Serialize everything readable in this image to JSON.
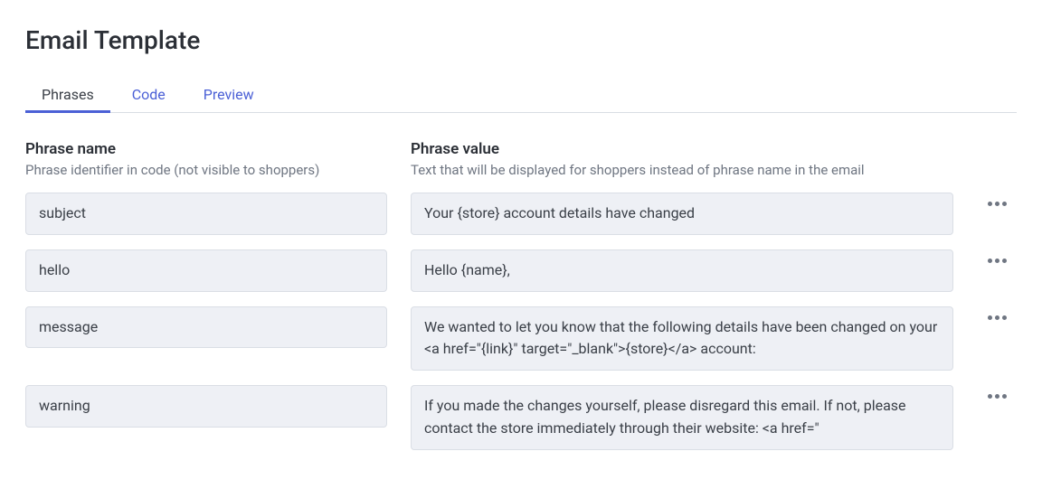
{
  "title": "Email Template",
  "tabs": [
    {
      "label": "Phrases",
      "active": true
    },
    {
      "label": "Code",
      "active": false
    },
    {
      "label": "Preview",
      "active": false
    }
  ],
  "columns": {
    "name": {
      "header": "Phrase name",
      "sub": "Phrase identifier in code (not visible to shoppers)"
    },
    "value": {
      "header": "Phrase value",
      "sub": "Text that will be displayed for shoppers instead of phrase name in the email"
    }
  },
  "rows": [
    {
      "name": "subject",
      "value": "Your {store} account details have changed"
    },
    {
      "name": "hello",
      "value": "Hello {name},"
    },
    {
      "name": "message",
      "value": "We wanted to let you know that the following details have been changed on your <a href=\"{link}\" target=\"_blank\">{store}</a> account:"
    },
    {
      "name": "warning",
      "value": "If you made the changes yourself, please disregard this email. If not, please contact the store immediately through their website: <a href=\""
    }
  ]
}
